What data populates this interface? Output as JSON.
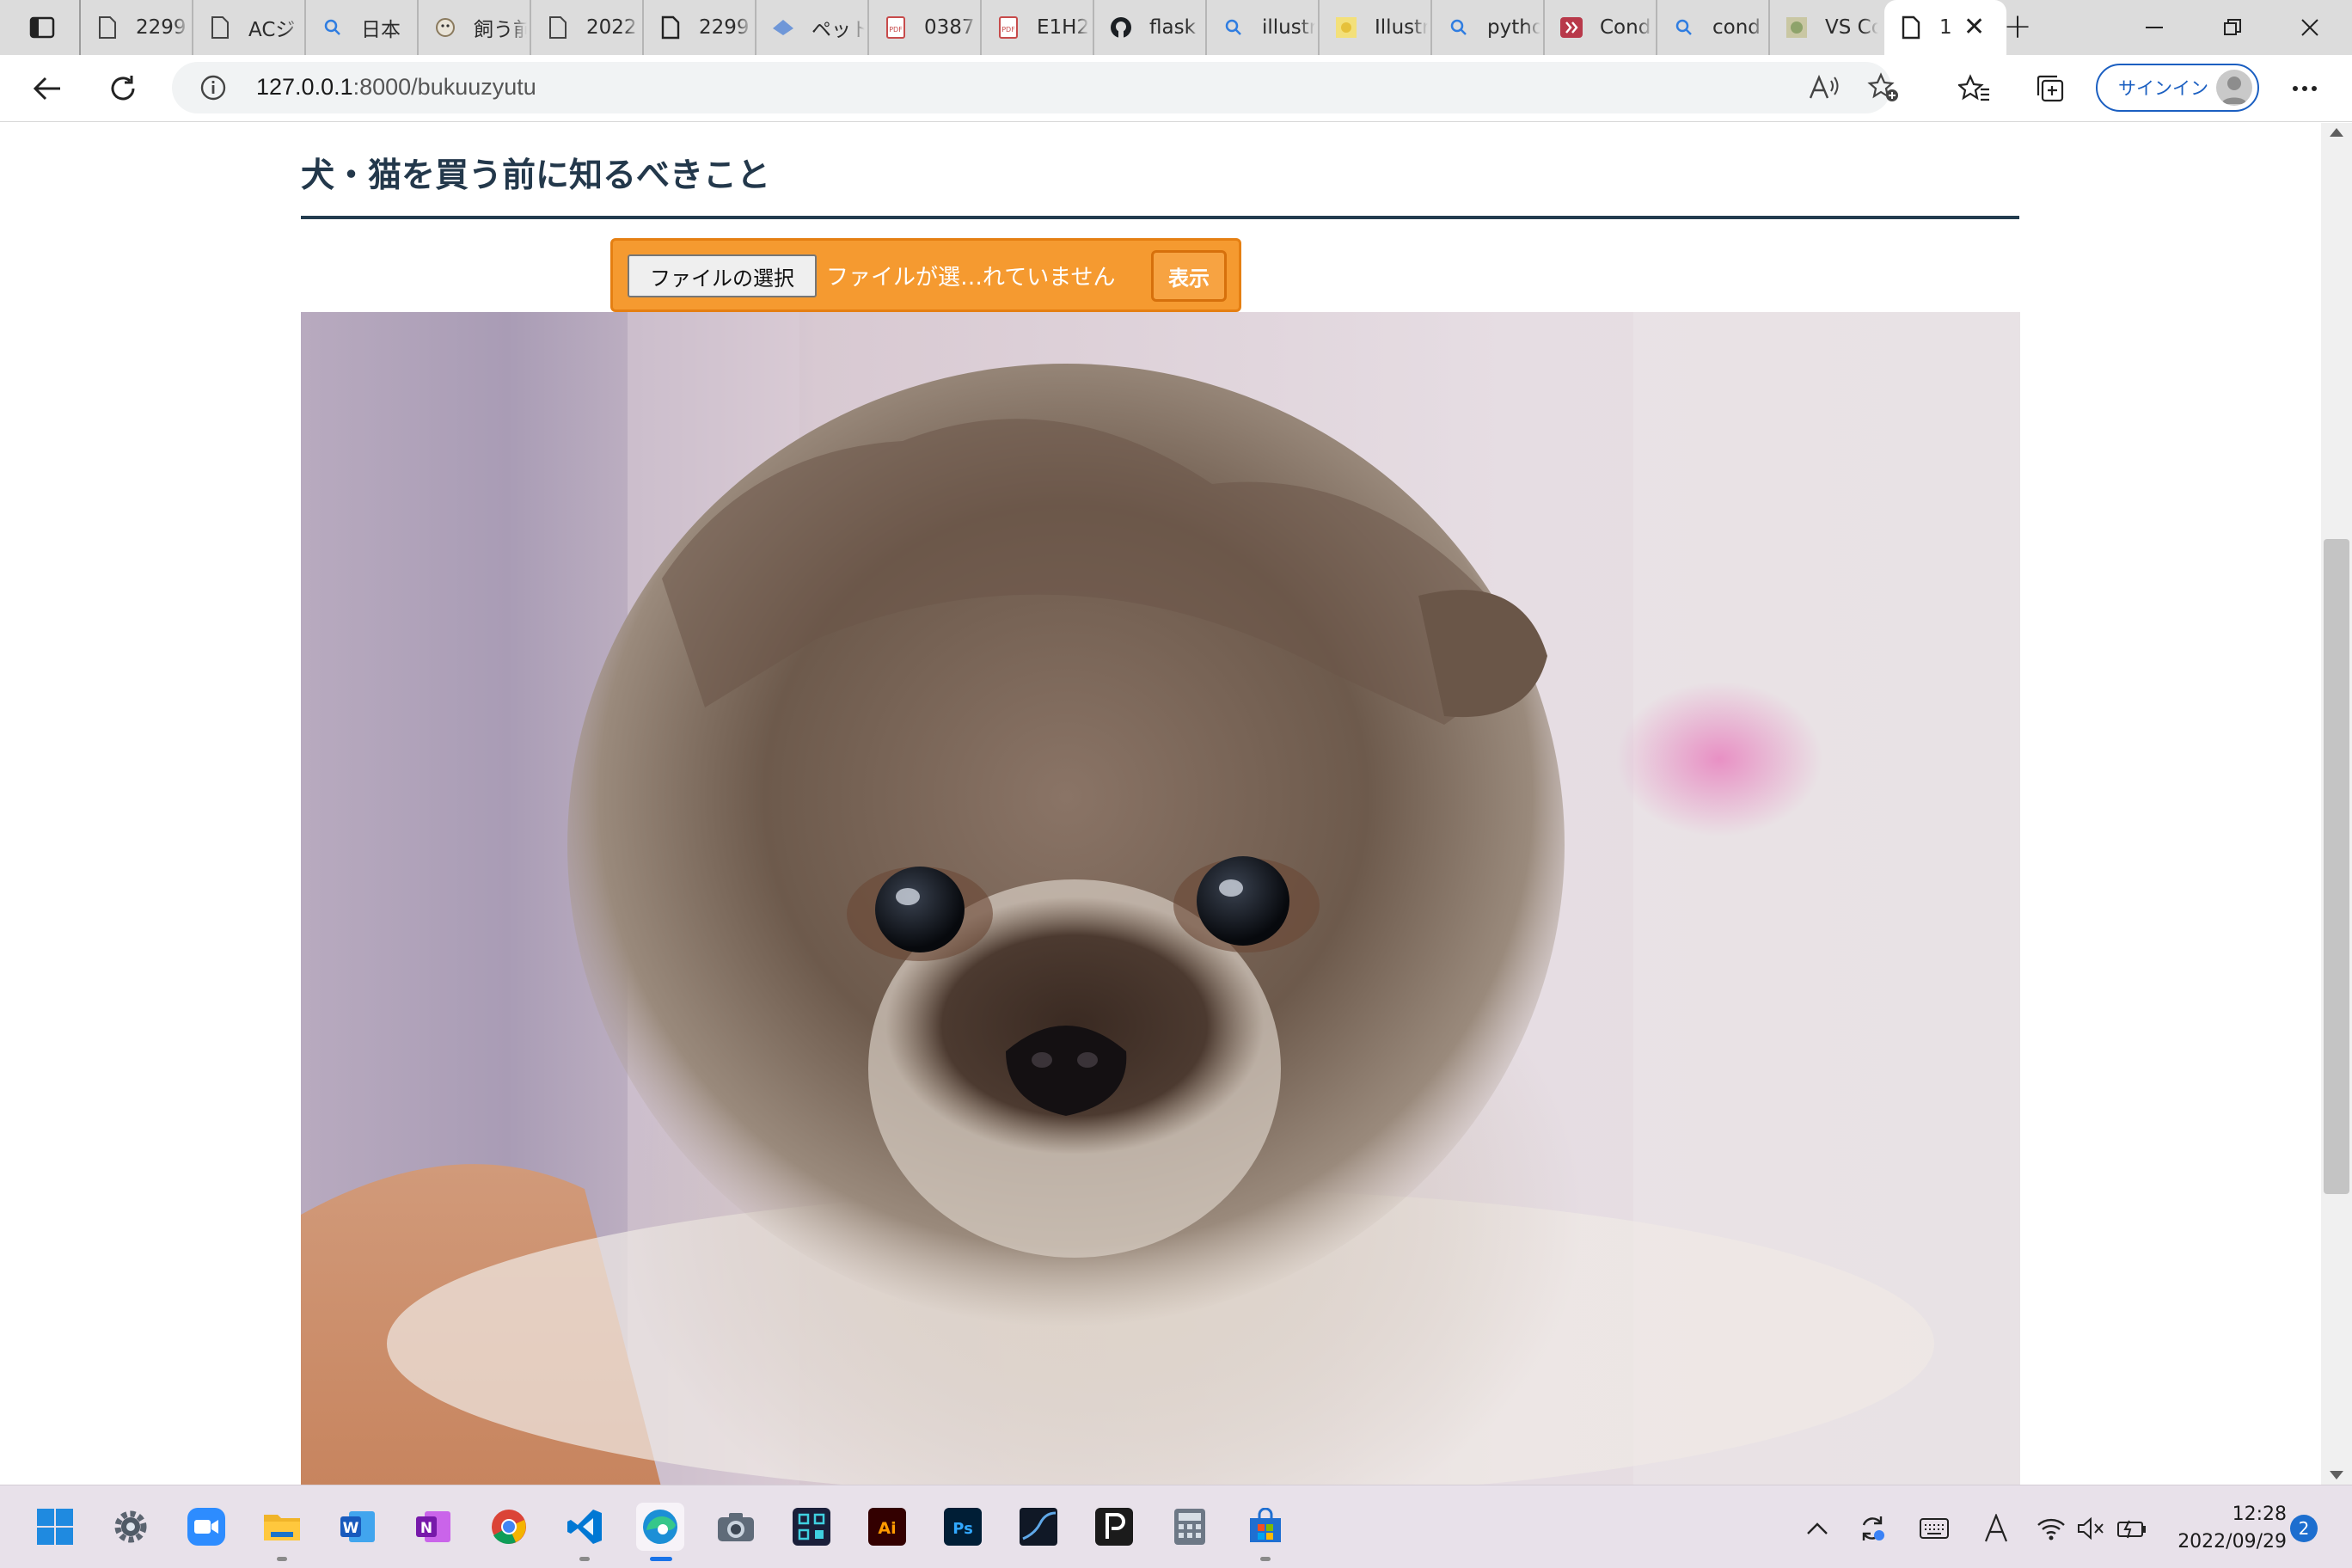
{
  "browser": {
    "tabs": [
      {
        "title": "2299",
        "icon": "page-icon"
      },
      {
        "title": "ACジ",
        "icon": "page-icon"
      },
      {
        "title": "日本",
        "icon": "search-icon"
      },
      {
        "title": "飼う前",
        "icon": "pet-site-icon"
      },
      {
        "title": "2022",
        "icon": "page-icon"
      },
      {
        "title": "2299",
        "icon": "page-icon"
      },
      {
        "title": "ペット",
        "icon": "paw-site-icon"
      },
      {
        "title": "0387",
        "icon": "pdf-icon"
      },
      {
        "title": "E1H2",
        "icon": "pdf-icon"
      },
      {
        "title": "flask",
        "icon": "github-icon"
      },
      {
        "title": "illustr",
        "icon": "search-icon"
      },
      {
        "title": "Illustr",
        "icon": "illust-site-icon"
      },
      {
        "title": "pytho",
        "icon": "search-icon"
      },
      {
        "title": "Cond",
        "icon": "conda-site-icon"
      },
      {
        "title": "cond",
        "icon": "search-icon"
      },
      {
        "title": "VS Co",
        "icon": "vscode-site-icon"
      }
    ],
    "active_tab": {
      "title": "1",
      "icon": "page-icon",
      "close": "✕"
    },
    "new_tab_label": "+",
    "url_host": "127.0.0.1",
    "url_rest": ":8000/bukuuzyutu",
    "signin_label": "サインイン"
  },
  "page": {
    "heading": "犬・猫を買う前に知るべきこと",
    "file_button_label": "ファイルの選択",
    "file_status": "ファイルが選…れていません",
    "show_button_label": "表示",
    "photo": "pomeranian-puppy-photo"
  },
  "taskbar": {
    "apps": [
      "start",
      "settings",
      "zoom",
      "file-explorer",
      "word",
      "onenote",
      "chrome",
      "vscode",
      "edge",
      "camera",
      "qr-app",
      "illustrator",
      "photoshop",
      "graph-app",
      "pdf-app",
      "calculator",
      "store"
    ],
    "time": "12:28",
    "date": "2022/09/29",
    "notification_count": "2"
  },
  "colors": {
    "heading_text": "#23384b",
    "heading_rule": "#233c4f",
    "form_orange": "#f59a30",
    "form_border": "#e57f12",
    "accent_blue": "#1b5fc1"
  }
}
